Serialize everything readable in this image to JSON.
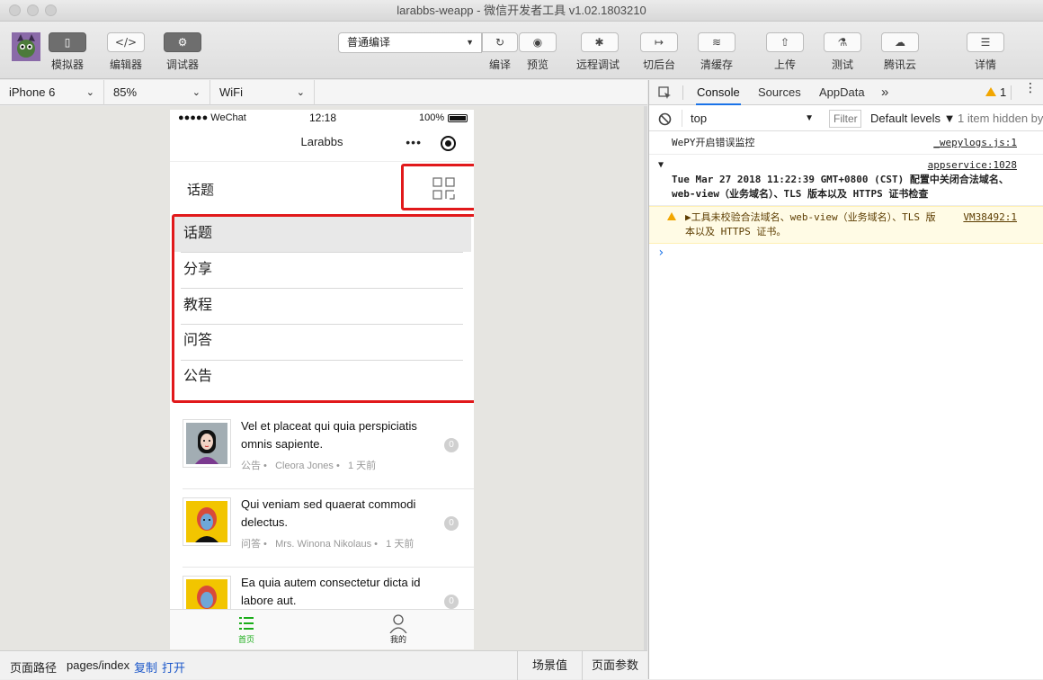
{
  "window": {
    "title": "larabbs-weapp - 微信开发者工具 v1.02.1803210"
  },
  "toolbar": {
    "simulator": "模拟器",
    "editor": "编辑器",
    "debugger": "调试器",
    "compile_mode": "普通编译",
    "compile": "编译",
    "preview": "预览",
    "remote_debug": "远程调试",
    "background": "切后台",
    "clear_cache": "清缓存",
    "upload": "上传",
    "test": "测试",
    "tencent_cloud": "腾讯云",
    "details": "详情",
    "icons": {
      "simulator": "▯",
      "editor": "</>",
      "debugger": "⚙",
      "compile": "↻",
      "preview": "◉",
      "remote_debug": "✱",
      "background": "↦",
      "clear_cache": "≋",
      "upload": "⇧",
      "test": "⚗",
      "tencent_cloud": "☁",
      "details": "☰"
    }
  },
  "sim_settings": {
    "device": "iPhone 6",
    "zoom": "85%",
    "network": "WiFi"
  },
  "phone": {
    "status": {
      "carrier": "●●●●● WeChat",
      "time": "12:18",
      "battery": "100%"
    },
    "nav_title": "Larabbs",
    "nav_dots": "•••",
    "header_title": "话题",
    "dropdown": [
      "话题",
      "分享",
      "教程",
      "问答",
      "公告"
    ],
    "posts": [
      {
        "title": "Vel et placeat qui quia perspiciatis omnis sapiente.",
        "category": "公告 •",
        "author": "Cleora Jones •",
        "time": "1 天前",
        "replies": "0"
      },
      {
        "title": "Qui veniam sed quaerat commodi delectus.",
        "category": "问答 •",
        "author": "Mrs. Winona Nikolaus •",
        "time": "1 天前",
        "replies": "0"
      },
      {
        "title": "Ea quia autem consectetur dicta id labore aut.",
        "category": "",
        "author": "",
        "time": "",
        "replies": "0"
      }
    ],
    "tabs": [
      {
        "label": "首页"
      },
      {
        "label": "我的"
      }
    ]
  },
  "bottom": {
    "path_label": "页面路径",
    "path": "pages/index",
    "copy": "复制",
    "open": "打开",
    "scene": "场景值",
    "params": "页面参数"
  },
  "devtools": {
    "tabs": [
      "Console",
      "Sources",
      "AppData"
    ],
    "more": "»",
    "warn_count": "1",
    "context": "top",
    "filter_placeholder": "Filter",
    "levels": "Default levels ▼",
    "hidden": "1 item hidden by",
    "logs": [
      {
        "text": "WePY开启错误监控",
        "source": "_wepylogs.js:1"
      },
      {
        "text": "Tue Mar 27 2018 11:22:39 GMT+0800 (CST) 配置中关闭合法域名、web-view（业务域名）、TLS 版本以及 HTTPS 证书检查",
        "source": "appservice:1028"
      },
      {
        "text": "▶工具未校验合法域名、web-view（业务域名）、TLS 版本以及 HTTPS 证书。",
        "source": "VM38492:1"
      }
    ],
    "prompt": "›"
  },
  "colors": {
    "accent": "#1aad19",
    "highlight": "#e1191b",
    "link": "#1a56c9"
  }
}
